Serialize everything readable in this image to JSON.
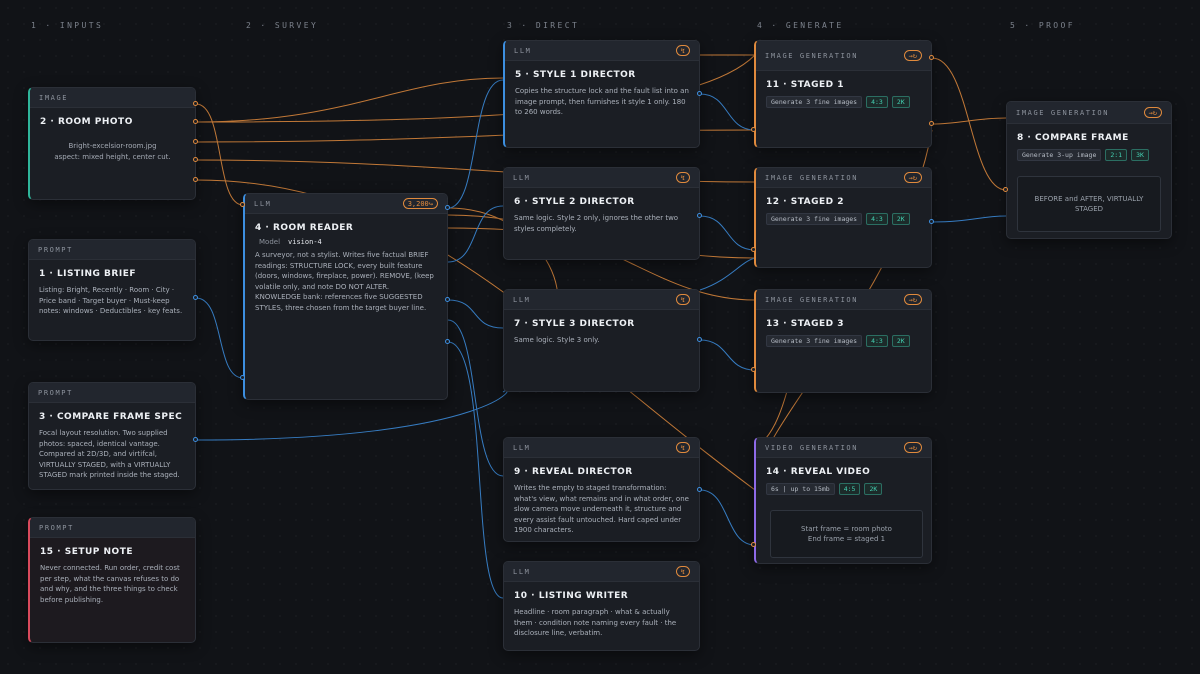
{
  "columns": [
    "1 · INPUTS",
    "2 · SURVEY",
    "3 · DIRECT",
    "4 · GENERATE",
    "5 · PROOF"
  ],
  "colors": {
    "orange": "#e08a3d",
    "blue": "#3d8fe0",
    "teal": "#2fb59a",
    "purple": "#8e6ae8",
    "red": "#d94a5c"
  },
  "nodes": {
    "n2": {
      "type": "IMAGE",
      "title": "2 · ROOM PHOTO",
      "file": "Bright-excelsior-room.jpg",
      "aspect": "aspect: mixed height, center cut."
    },
    "n1": {
      "type": "PROMPT",
      "title": "1 · LISTING BRIEF",
      "body": "Listing: Bright, Recently · Room · City · Price band · Target buyer · Must-keep notes: windows · Deductibles · key feats."
    },
    "n3": {
      "type": "PROMPT",
      "title": "3 · COMPARE FRAME SPEC",
      "body": "Focal layout resolution. Two supplied photos: spaced, identical vantage. Compared at 2D/3D, and virtifcal, VIRTUALLY STAGED, with a VIRTUALLY STAGED mark printed inside the staged."
    },
    "n15": {
      "type": "PROMPT",
      "title": "15 · SETUP NOTE",
      "body": "Never connected. Run order, credit cost per step, what the canvas refuses to do and why, and the three things to check before publishing."
    },
    "n4": {
      "type": "LLM",
      "badge": "3,200",
      "title": "4 · ROOM READER",
      "model_label": "Model",
      "model": "vision-4",
      "body": "A surveyor, not a stylist. Writes five factual BRIEF readings: STRUCTURE LOCK, every built feature (doors, windows, fireplace, power). REMOVE, (keep volatile only, and note DO NOT ALTER. KNOWLEDGE bank: references five SUGGESTED STYLES, three chosen from the target buyer line."
    },
    "n5": {
      "type": "LLM",
      "title": "5 · STYLE 1 DIRECTOR",
      "body": "Copies the structure lock and the fault list into an image prompt, then furnishes it style 1 only. 180 to 260 words."
    },
    "n6": {
      "type": "LLM",
      "title": "6 · STYLE 2 DIRECTOR",
      "body": "Same logic. Style 2 only, ignores the other two styles completely."
    },
    "n7": {
      "type": "LLM",
      "title": "7 · STYLE 3 DIRECTOR",
      "body": "Same logic. Style 3 only."
    },
    "n9": {
      "type": "LLM",
      "title": "9 · REVEAL DIRECTOR",
      "body": "Writes the empty to staged transformation: what's view, what remains and in what order, one slow camera move underneath it, structure and every assist fault untouched. Hard caped under 1900 characters."
    },
    "n10": {
      "type": "LLM",
      "title": "10 · LISTING WRITER",
      "body": "Headline · room paragraph · what & actually them · condition note naming every fault · the disclosure line, verbatim."
    },
    "n11": {
      "type": "IMAGE GENERATION",
      "title": "11 · STAGED 1",
      "chips": [
        "Generate 3 fine images",
        "4:3",
        "2K"
      ]
    },
    "n12": {
      "type": "IMAGE GENERATION",
      "title": "12 · STAGED 2",
      "chips": [
        "Generate 3 fine images",
        "4:3",
        "2K"
      ]
    },
    "n13": {
      "type": "IMAGE GENERATION",
      "title": "13 · STAGED 3",
      "chips": [
        "Generate 3 fine images",
        "4:3",
        "2K"
      ]
    },
    "n14": {
      "type": "VIDEO GENERATION",
      "title": "14 · REVEAL VIDEO",
      "chips": [
        "6s | up to 15mb",
        "4:5",
        "2K"
      ],
      "frame_start": "Start frame = room photo",
      "frame_end": "End frame = staged 1"
    },
    "n8": {
      "type": "IMAGE GENERATION",
      "title": "8 · COMPARE FRAME",
      "chips": [
        "Generate 3-up image",
        "2:1",
        "3K"
      ],
      "preview": "BEFORE and AFTER, VIRTUALLY STAGED"
    }
  },
  "icons": {
    "llm_badge": "bolt-icon",
    "gen_badge": "link-arrow-icon"
  }
}
